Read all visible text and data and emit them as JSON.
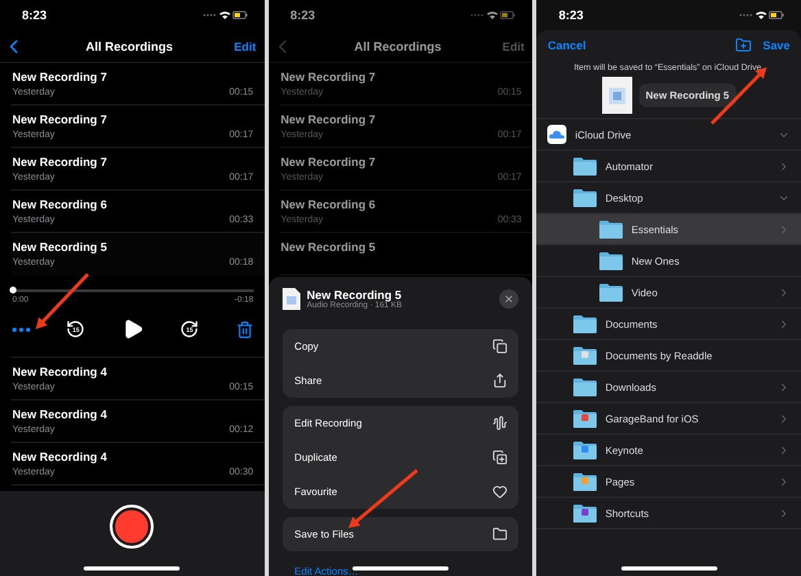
{
  "recordings_screen": {
    "status_bar": {
      "time": "8:23"
    },
    "dimmed": false,
    "nav": {
      "title": "All Recordings",
      "edit": "Edit"
    },
    "recordings": [
      {
        "name": "New Recording 7",
        "date": "Yesterday",
        "duration": "00:15",
        "expanded": false
      },
      {
        "name": "New Recording 7",
        "date": "Yesterday",
        "duration": "00:17",
        "expanded": false
      },
      {
        "name": "New Recording 7",
        "date": "Yesterday",
        "duration": "00:17",
        "expanded": false
      },
      {
        "name": "New Recording 6",
        "date": "Yesterday",
        "duration": "00:33",
        "expanded": false
      },
      {
        "name": "New Recording 5",
        "date": "Yesterday",
        "duration": "00:18",
        "expanded": true
      },
      {
        "name": "New Recording 4",
        "date": "Yesterday",
        "duration": "00:15",
        "expanded": false
      },
      {
        "name": "New Recording 4",
        "date": "Yesterday",
        "duration": "00:12",
        "expanded": false
      },
      {
        "name": "New Recording 4",
        "date": "Yesterday",
        "duration": "00:30",
        "expanded": false
      }
    ],
    "player": {
      "level": 0,
      "elapsed": "0:00",
      "remaining": "-0:18",
      "skip_back": "15",
      "skip_forward": "15"
    }
  },
  "actions_screen": {
    "status_bar": {
      "time": "8:23"
    },
    "dimmed": true,
    "nav": {
      "title": "All Recordings",
      "edit": "Edit"
    },
    "recordings": [
      {
        "name": "New Recording 7",
        "date": "Yesterday",
        "duration": "00:15"
      },
      {
        "name": "New Recording 7",
        "date": "Yesterday",
        "duration": "00:17"
      },
      {
        "name": "New Recording 7",
        "date": "Yesterday",
        "duration": "00:17"
      },
      {
        "name": "New Recording 6",
        "date": "Yesterday",
        "duration": "00:33"
      },
      {
        "name": "New Recording 5"
      }
    ],
    "sheet": {
      "file_name": "New Recording 5",
      "file_info": "Audio Recording · 161 KB",
      "groups": [
        [
          {
            "label": "Copy"
          },
          {
            "label": "Share"
          }
        ],
        [
          {
            "label": "Edit Recording"
          },
          {
            "label": "Duplicate"
          },
          {
            "label": "Favourite"
          }
        ],
        [
          {
            "label": "Save to Files"
          }
        ]
      ],
      "edit_actions": "Edit Actions…"
    }
  },
  "save_screen": {
    "status_bar": {
      "time": "8:23"
    },
    "cancel": "Cancel",
    "save": "Save",
    "message": "Item will be saved to “Essentials” on iCloud Drive.",
    "file_name": "New Recording 5",
    "locations": [
      {
        "name": "iCloud Drive",
        "expanded": true,
        "has_children": true,
        "selected": false,
        "children": [
          {
            "name": "Automator",
            "has_children": true,
            "selected": false
          },
          {
            "name": "Desktop",
            "expanded": true,
            "has_children": true,
            "selected": false,
            "children": [
              {
                "name": "Essentials",
                "has_children": true,
                "selected": true
              },
              {
                "name": "New Ones",
                "has_children": false,
                "selected": false
              },
              {
                "name": "Video",
                "has_children": true,
                "selected": false
              }
            ]
          },
          {
            "name": "Documents",
            "has_children": true,
            "selected": false
          },
          {
            "name": "Documents by Readdle",
            "has_children": false,
            "selected": false,
            "color": "#e0e0e0"
          },
          {
            "name": "Downloads",
            "has_children": true,
            "selected": false
          },
          {
            "name": "GarageBand for iOS",
            "has_children": true,
            "selected": false,
            "color": "#e8483c"
          },
          {
            "name": "Keynote",
            "has_children": true,
            "selected": false,
            "color": "#2f8ff0"
          },
          {
            "name": "Pages",
            "has_children": true,
            "selected": false,
            "color": "#f0a030"
          },
          {
            "name": "Shortcuts",
            "has_children": true,
            "selected": false,
            "color": "#7a3fd0"
          }
        ]
      }
    ]
  }
}
